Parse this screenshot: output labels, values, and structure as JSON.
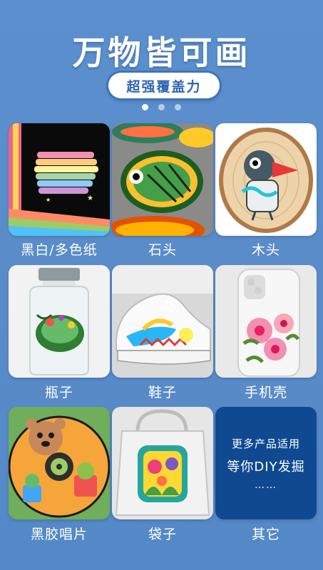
{
  "header": {
    "title": "万物皆可画",
    "subtitle": "超强覆盖力"
  },
  "carousel": {
    "dots": 3,
    "active_index": 0
  },
  "items": [
    {
      "label": "黑白/多色纸",
      "icon": "colored-paper-image"
    },
    {
      "label": "石头",
      "icon": "painted-stone-image"
    },
    {
      "label": "木头",
      "icon": "painted-wood-image"
    },
    {
      "label": "瓶子",
      "icon": "painted-bottle-image"
    },
    {
      "label": "鞋子",
      "icon": "painted-shoe-image"
    },
    {
      "label": "手机壳",
      "icon": "phone-case-image"
    },
    {
      "label": "黑胶唱片",
      "icon": "vinyl-record-image"
    },
    {
      "label": "袋子",
      "icon": "painted-bag-image"
    },
    {
      "label": "其它"
    }
  ],
  "other_card": {
    "line1": "更多产品适用",
    "line2": "等你DIY发掘",
    "line3": "……"
  },
  "colors": {
    "background": "#5a8cc8",
    "pill_text": "#2f66b1",
    "other_card": "#0f4a91"
  }
}
